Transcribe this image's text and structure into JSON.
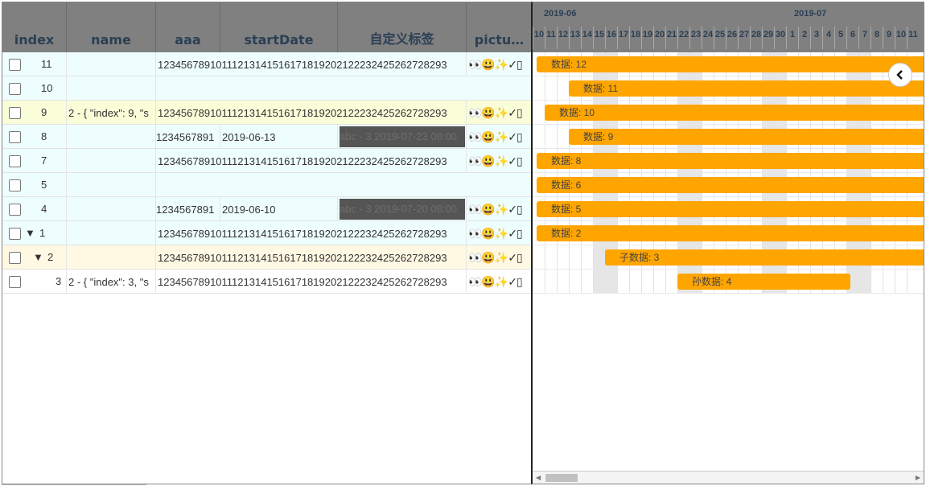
{
  "columns": [
    "index",
    "name",
    "aaa",
    "startDate",
    "自定义标签",
    "pictu…"
  ],
  "icons": [
    "checkbox-icon",
    "expand-triangle-icon",
    "chevron-left-icon",
    "scroll-left-arrow-icon",
    "scroll-right-arrow-icon"
  ],
  "rows": [
    {
      "index": "11",
      "name": "",
      "aaa": "12345678910111213141516171819202122232425262728293",
      "start": "",
      "tag": "",
      "pic": "👀😃✨✓▯",
      "type": "merged",
      "bg": "blue"
    },
    {
      "index": "10",
      "name": "",
      "aaa": "",
      "start": "",
      "tag": "",
      "pic": "",
      "type": "empty",
      "bg": "blue"
    },
    {
      "index": "9",
      "name": "2 - { \"index\": 9, \"s",
      "aaa": "12345678910111213141516171819202122232425262728293",
      "start": "",
      "tag": "",
      "pic": "👀😃✨✓▯",
      "type": "merged",
      "bg": "yellow"
    },
    {
      "index": "8",
      "name": "",
      "aaa": "1234567891",
      "start": "2019-06-13",
      "tag": "abc - 3 2019-07-23 08:00",
      "pic": "👀😃✨✓▯",
      "type": "split",
      "bg": "blue"
    },
    {
      "index": "7",
      "name": "",
      "aaa": "12345678910111213141516171819202122232425262728293",
      "start": "",
      "tag": "",
      "pic": "👀😃✨✓▯",
      "type": "merged",
      "bg": "blue"
    },
    {
      "index": "5",
      "name": "",
      "aaa": "",
      "start": "",
      "tag": "",
      "pic": "",
      "type": "empty",
      "bg": "blue"
    },
    {
      "index": "4",
      "name": "",
      "aaa": "1234567891",
      "start": "2019-06-10",
      "tag": "abc - 3 2019-07-20 08:00",
      "pic": "👀😃✨✓▯",
      "type": "split",
      "bg": "blue"
    },
    {
      "index": "1",
      "name": "",
      "aaa": "12345678910111213141516171819202122232425262728293",
      "start": "",
      "tag": "",
      "pic": "👀😃✨✓▯",
      "type": "merged",
      "bg": "blue",
      "tree": "parent"
    },
    {
      "index": "2",
      "name": "",
      "aaa": "12345678910111213141516171819202122232425262728293",
      "start": "",
      "tag": "",
      "pic": "👀😃✨✓▯",
      "type": "merged",
      "bg": "cream",
      "tree": "child"
    },
    {
      "index": "3",
      "name": "2 - { \"index\": 3, \"s",
      "aaa": "12345678910111213141516171819202122232425262728293",
      "start": "",
      "tag": "",
      "pic": "👀😃✨✓▯",
      "type": "merged",
      "bg": "white",
      "tree": "grandchild"
    }
  ],
  "gantt": {
    "months": [
      "2019-06",
      "2019-07"
    ],
    "days": [
      "10",
      "11",
      "12",
      "13",
      "14",
      "15",
      "16",
      "17",
      "18",
      "19",
      "20",
      "21",
      "22",
      "23",
      "24",
      "25",
      "26",
      "27",
      "28",
      "29",
      "30",
      "1",
      "2",
      "3",
      "4",
      "5",
      "6",
      "7",
      "8",
      "9",
      "10",
      "11"
    ],
    "weekend_days": [
      "15",
      "16",
      "22",
      "23",
      "29",
      "30",
      "6",
      "7"
    ],
    "bars": [
      {
        "label": "数据: 12",
        "start": "10",
        "open": true
      },
      {
        "label": "数据: 11",
        "start": "13",
        "open": true
      },
      {
        "label": "数据: 10",
        "start": "11",
        "open": true
      },
      {
        "label": "数据: 9",
        "start": "13",
        "open": true
      },
      {
        "label": "数据: 8",
        "start": "10",
        "open": true
      },
      {
        "label": "数据: 6",
        "start": "10",
        "open": true
      },
      {
        "label": "数据: 5",
        "start": "10",
        "open": true
      },
      {
        "label": "数据: 2",
        "start": "10",
        "open": true
      },
      {
        "label": "子数据: 3",
        "start": "16",
        "open": true
      },
      {
        "label": "孙数据: 4",
        "start": "22",
        "end": "4",
        "open": false
      }
    ]
  }
}
